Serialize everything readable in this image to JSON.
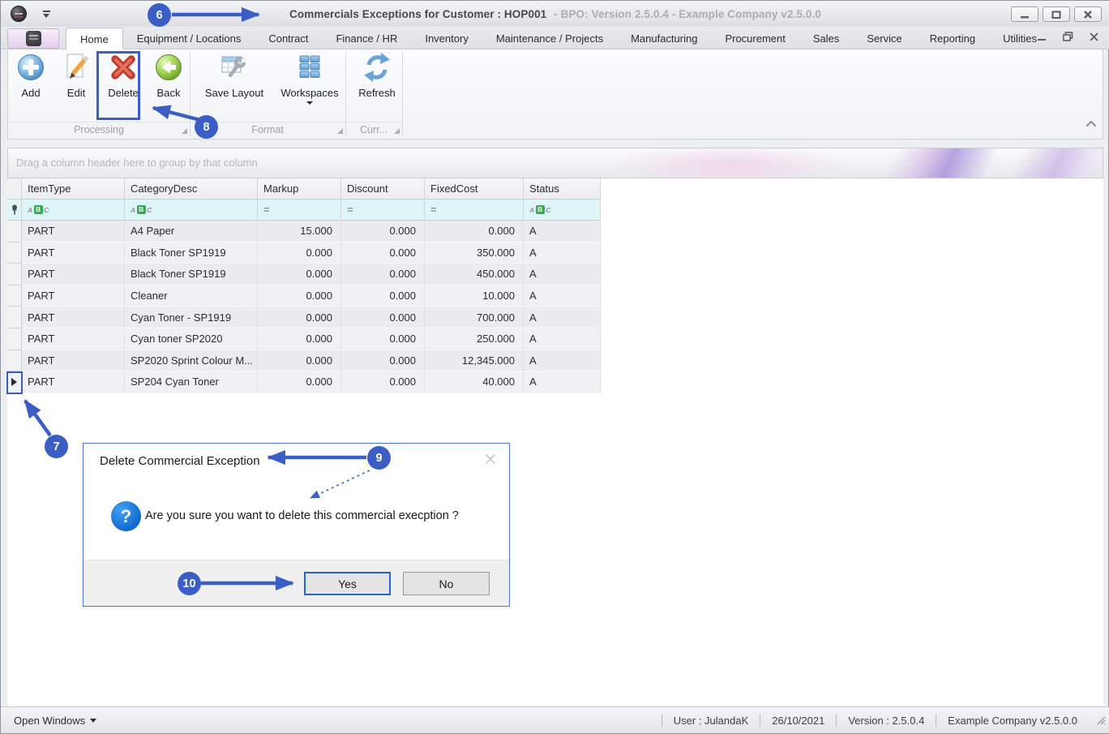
{
  "window": {
    "title_primary": "Commercials Exceptions for Customer : HOP001",
    "title_secondary": "- BPO: Version 2.5.0.4 - Example Company v2.5.0.0"
  },
  "tabs": [
    {
      "label": "Home",
      "selected": true
    },
    {
      "label": "Equipment / Locations"
    },
    {
      "label": "Contract"
    },
    {
      "label": "Finance / HR"
    },
    {
      "label": "Inventory"
    },
    {
      "label": "Maintenance / Projects"
    },
    {
      "label": "Manufacturing"
    },
    {
      "label": "Procurement"
    },
    {
      "label": "Sales"
    },
    {
      "label": "Service"
    },
    {
      "label": "Reporting"
    },
    {
      "label": "Utilities"
    }
  ],
  "ribbon": {
    "buttons": [
      {
        "label": "Add"
      },
      {
        "label": "Edit"
      },
      {
        "label": "Delete"
      },
      {
        "label": "Back"
      },
      {
        "label": "Save Layout"
      },
      {
        "label": "Workspaces"
      },
      {
        "label": "Refresh"
      }
    ],
    "groups": [
      {
        "label": "Processing"
      },
      {
        "label": "Format"
      },
      {
        "label": "Curr..."
      }
    ]
  },
  "grid": {
    "group_panel_text": "Drag a column header here to group by that column",
    "columns": [
      "ItemType",
      "CategoryDesc",
      "Markup",
      "Discount",
      "FixedCost",
      "Status"
    ],
    "filters": [
      {
        "type": "text"
      },
      {
        "type": "text"
      },
      {
        "type": "equals"
      },
      {
        "type": "equals"
      },
      {
        "type": "equals"
      },
      {
        "type": "text"
      }
    ],
    "text_filter_letters": [
      "A",
      "B",
      "C"
    ],
    "equals_glyph": "=",
    "rows": [
      [
        "PART",
        "A4 Paper",
        "15.000",
        "0.000",
        "0.000",
        "A"
      ],
      [
        "PART",
        "Black Toner SP1919",
        "0.000",
        "0.000",
        "350.000",
        "A"
      ],
      [
        "PART",
        "Black Toner SP1919",
        "0.000",
        "0.000",
        "450.000",
        "A"
      ],
      [
        "PART",
        "Cleaner",
        "0.000",
        "0.000",
        "10.000",
        "A"
      ],
      [
        "PART",
        "Cyan Toner - SP1919",
        "0.000",
        "0.000",
        "700.000",
        "A"
      ],
      [
        "PART",
        "Cyan toner SP2020",
        "0.000",
        "0.000",
        "250.000",
        "A"
      ],
      [
        "PART",
        "SP2020 Sprint Colour M...",
        "0.000",
        "0.000",
        "12,345.000",
        "A"
      ],
      [
        "PART",
        "SP204 Cyan Toner",
        "0.000",
        "0.000",
        "40.000",
        "A"
      ]
    ]
  },
  "dialog": {
    "title": "Delete Commercial Exception",
    "message": "Are you sure you want to delete this commercial execption ?",
    "yes_label": "Yes",
    "no_label": "No"
  },
  "statusbar": {
    "open_windows_label": "Open Windows",
    "items": [
      "User : JulandaK",
      "26/10/2021",
      "Version : 2.5.0.4",
      "Example Company v2.5.0.0"
    ]
  },
  "annotations": {
    "accent_color": "#3a5ec6",
    "callouts": [
      {
        "number": "6"
      },
      {
        "number": "7"
      },
      {
        "number": "8"
      },
      {
        "number": "9"
      },
      {
        "number": "10"
      }
    ]
  }
}
